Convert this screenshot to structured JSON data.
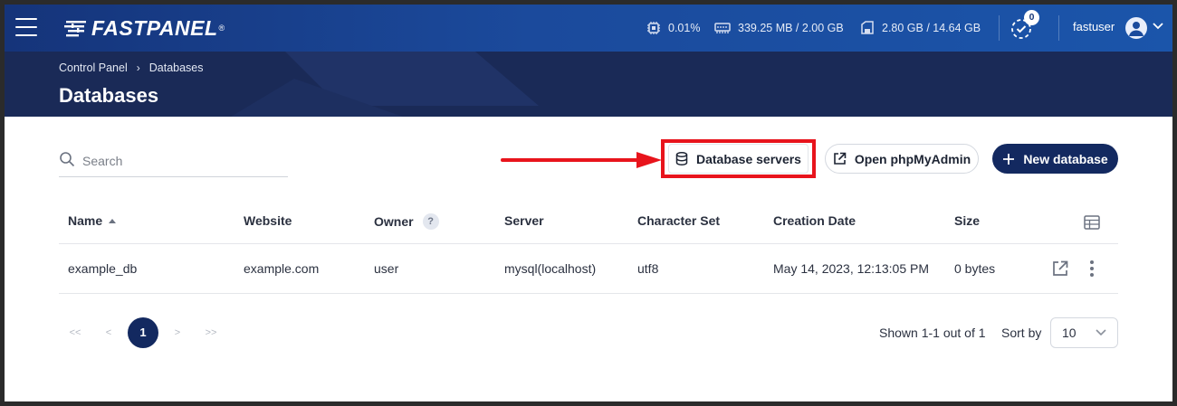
{
  "topbar": {
    "logo_text": "FASTPANEL",
    "logo_reg": "®",
    "cpu": "0.01%",
    "ram": "339.25 MB / 2.00 GB",
    "disk": "2.80 GB / 14.64 GB",
    "notifications": "0",
    "username": "fastuser"
  },
  "header": {
    "breadcrumb": [
      "Control Panel",
      "Databases"
    ],
    "breadcrumb_sep": "›",
    "title": "Databases"
  },
  "toolbar": {
    "search_placeholder": "Search",
    "db_servers_label": "Database servers",
    "phpmyadmin_label": "Open phpMyAdmin",
    "new_db_label": "New database"
  },
  "table": {
    "columns": [
      "Name",
      "Website",
      "Owner",
      "Server",
      "Character Set",
      "Creation Date",
      "Size"
    ],
    "owner_help": "?",
    "rows": [
      {
        "name": "example_db",
        "website": "example.com",
        "owner": "user",
        "server": "mysql(localhost)",
        "charset": "utf8",
        "created": "May 14, 2023, 12:13:05 PM",
        "size": "0 bytes"
      }
    ]
  },
  "pagination": {
    "first": "<<",
    "prev": "<",
    "current": "1",
    "next": ">",
    "last": ">>",
    "shown": "Shown 1-1 out of 1",
    "sort_by_label": "Sort by",
    "page_size": "10"
  },
  "colors": {
    "topbar": "#1b4a9c",
    "band": "#1a2a57",
    "primary": "#132960",
    "highlight": "#e8141c"
  }
}
